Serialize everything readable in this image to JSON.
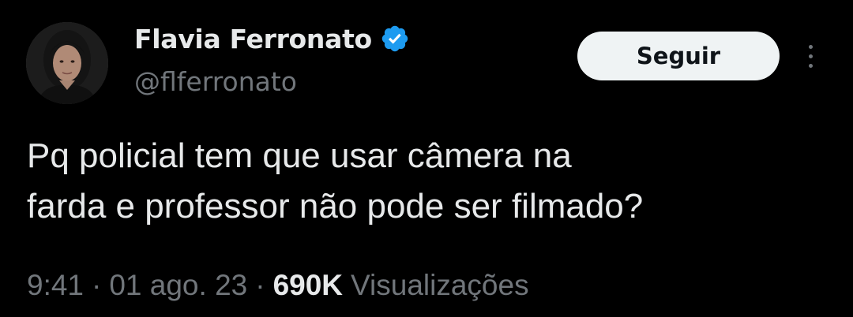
{
  "author": {
    "display_name": "Flavia Ferronato",
    "handle": "@flferronato",
    "verified": true,
    "verified_color": "#1d9bf0"
  },
  "actions": {
    "follow_label": "Seguir",
    "more_icon": "more-vertical-icon"
  },
  "tweet": {
    "text_lines": [
      "Pq policial tem que usar câmera na",
      "farda e professor não pode ser filmado?"
    ]
  },
  "meta": {
    "time": "9:41",
    "separator": "·",
    "date": "01 ago. 23",
    "views_count": "690K",
    "views_label": "Visualizações"
  },
  "colors": {
    "background": "#000000",
    "primary_text": "#e7e9ea",
    "secondary_text": "#71767b",
    "button_bg": "#eff3f4",
    "button_text": "#0f1419"
  }
}
